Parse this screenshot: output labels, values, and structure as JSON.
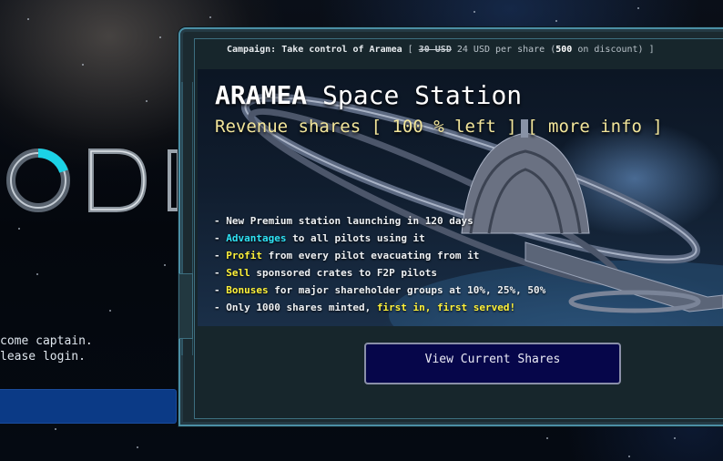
{
  "login": {
    "logo_text": "ODI",
    "welcome_line1": "come captain.",
    "welcome_line2": "lease login."
  },
  "modal": {
    "campaign": {
      "label": "Campaign: Take control of Aramea",
      "open_bracket": " [ ",
      "old_price": "30 USD",
      "new_price": " 24 USD per share (",
      "discount_count": "500",
      "discount_text": " on discount) ]"
    },
    "title_bold": "ARAMEA",
    "title_rest": " Space Station",
    "subtitle": "Revenue shares [ 100 % left ] [ more info ]",
    "bullets": [
      {
        "prefix": "- New Premium station launching in 120 days",
        "hl": "",
        "rest": "",
        "hl2": ""
      },
      {
        "prefix": "- ",
        "hl": "Advantages",
        "rest": " to all pilots using it",
        "hl2": ""
      },
      {
        "prefix": "- ",
        "hl": "Profit",
        "rest": " from every pilot evacuating from it",
        "hl2": ""
      },
      {
        "prefix": "- ",
        "hl": "Sell",
        "rest": " sponsored crates to F2P pilots",
        "hl2": ""
      },
      {
        "prefix": "- ",
        "hl": "Bonuses",
        "rest": " for major shareholder groups at 10%, 25%, 50%",
        "hl2": ""
      },
      {
        "prefix": "- Only 1000 shares minted, ",
        "hl": "",
        "rest": "",
        "hl2": "first in, first served!"
      }
    ],
    "view_button": "View Current Shares"
  },
  "colors": {
    "accent_cyan": "#2fe3f5",
    "accent_yellow": "#fff23a",
    "subtitle_yellow": "#f2e59a",
    "button_navy": "#06064a",
    "login_blue": "#0b3a86"
  }
}
